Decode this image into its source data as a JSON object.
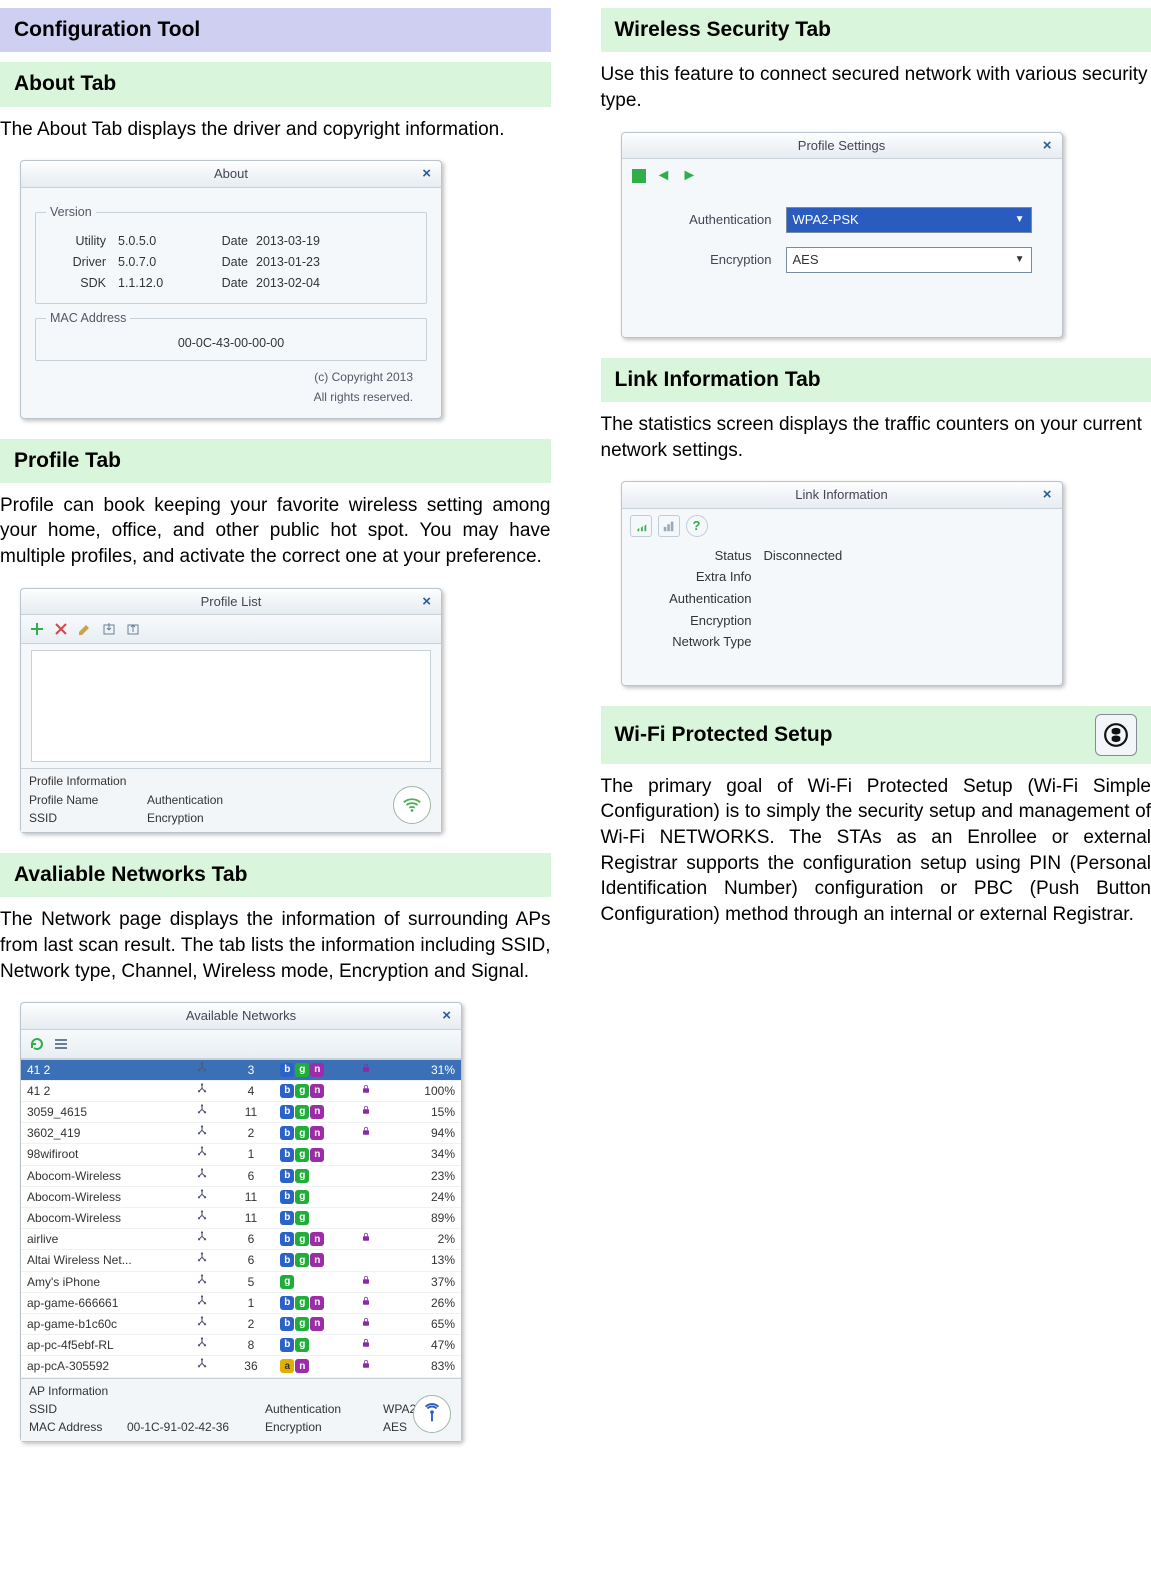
{
  "sections": {
    "config_tool": "Configuration Tool",
    "about": "About Tab",
    "profile": "Profile Tab",
    "avail": "Avaliable Networks Tab",
    "wireless_sec": "Wireless Security Tab",
    "link_info": "Link Information Tab",
    "wps": "Wi-Fi Protected Setup"
  },
  "text": {
    "about_desc": "The About Tab displays the driver and copyright information.",
    "profile_desc": "Profile can book keeping your favorite wireless setting among your home, office, and other public hot spot. You may have multiple profiles, and activate the correct one at your preference.",
    "avail_desc": "The Network page displays the information of surrounding APs from last scan result. The tab lists the information including SSID, Network type, Channel, Wireless mode, Encryption and Signal.",
    "wireless_sec_desc": "Use this feature to connect secured network with various security type.",
    "link_info_desc": "The statistics screen displays the traffic counters on your current network settings.",
    "wps_desc": "The primary goal of Wi-Fi Protected Setup (Wi-Fi Simple Configuration) is to simply the security setup and management of Wi-Fi NETWORKS. The STAs as an Enrollee or external Registrar supports the configuration setup using PIN (Personal Identification Number) configuration or PBC (Push Button Configuration) method through an internal or external Registrar."
  },
  "about_window": {
    "title": "About",
    "version_legend": "Version",
    "mac_legend": "MAC Address",
    "labels": {
      "utility": "Utility",
      "driver": "Driver",
      "sdk": "SDK",
      "date": "Date"
    },
    "utility": "5.0.5.0",
    "utility_date": "2013-03-19",
    "driver": "5.0.7.0",
    "driver_date": "2013-01-23",
    "sdk": "1.1.12.0",
    "sdk_date": "2013-02-04",
    "mac": "00-0C-43-00-00-00",
    "copyright1": "(c) Copyright 2013",
    "copyright2": "All rights reserved."
  },
  "profile_window": {
    "title": "Profile List",
    "info_legend": "Profile Information",
    "profile_name_label": "Profile Name",
    "ssid_label": "SSID",
    "auth_label": "Authentication",
    "enc_label": "Encryption"
  },
  "networks_window": {
    "title": "Available Networks",
    "ap_info_legend": "AP Information",
    "ssid_label": "SSID",
    "mac_label": "MAC Address",
    "auth_label": "Authentication",
    "enc_label": "Encryption",
    "ssid_value": "",
    "mac_value": "00-1C-91-02-42-36",
    "auth_value": "WPA2-PSK",
    "enc_value": "AES",
    "rows": [
      {
        "ssid": "41 2",
        "ch": "3",
        "modes": [
          "b",
          "g",
          "n"
        ],
        "lock": true,
        "sig": "31%",
        "sel": true
      },
      {
        "ssid": "41 2",
        "ch": "4",
        "modes": [
          "b",
          "g",
          "n"
        ],
        "lock": true,
        "sig": "100%"
      },
      {
        "ssid": "3059_4615",
        "ch": "11",
        "modes": [
          "b",
          "g",
          "n"
        ],
        "lock": true,
        "sig": "15%"
      },
      {
        "ssid": "3602_419",
        "ch": "2",
        "modes": [
          "b",
          "g",
          "n"
        ],
        "lock": true,
        "sig": "94%"
      },
      {
        "ssid": "98wifiroot",
        "ch": "1",
        "modes": [
          "b",
          "g",
          "n"
        ],
        "lock": false,
        "sig": "34%"
      },
      {
        "ssid": "Abocom-Wireless",
        "ch": "6",
        "modes": [
          "b",
          "g"
        ],
        "lock": false,
        "sig": "23%"
      },
      {
        "ssid": "Abocom-Wireless",
        "ch": "11",
        "modes": [
          "b",
          "g"
        ],
        "lock": false,
        "sig": "24%"
      },
      {
        "ssid": "Abocom-Wireless",
        "ch": "11",
        "modes": [
          "b",
          "g"
        ],
        "lock": false,
        "sig": "89%"
      },
      {
        "ssid": "airlive",
        "ch": "6",
        "modes": [
          "b",
          "g",
          "n"
        ],
        "lock": true,
        "sig": "2%"
      },
      {
        "ssid": "Altai Wireless Net...",
        "ch": "6",
        "modes": [
          "b",
          "g",
          "n"
        ],
        "lock": false,
        "sig": "13%"
      },
      {
        "ssid": "Amy's iPhone",
        "ch": "5",
        "modes": [
          "g"
        ],
        "lock": true,
        "sig": "37%"
      },
      {
        "ssid": "ap-game-666661",
        "ch": "1",
        "modes": [
          "b",
          "g",
          "n"
        ],
        "lock": true,
        "sig": "26%"
      },
      {
        "ssid": "ap-game-b1c60c",
        "ch": "2",
        "modes": [
          "b",
          "g",
          "n"
        ],
        "lock": true,
        "sig": "65%"
      },
      {
        "ssid": "ap-pc-4f5ebf-RL",
        "ch": "8",
        "modes": [
          "b",
          "g"
        ],
        "lock": true,
        "sig": "47%"
      },
      {
        "ssid": "ap-pcA-305592",
        "ch": "36",
        "modes": [
          "a",
          "n"
        ],
        "lock": true,
        "sig": "83%"
      }
    ]
  },
  "profile_settings_window": {
    "title": "Profile Settings",
    "auth_label": "Authentication",
    "enc_label": "Encryption",
    "auth_value": "WPA2-PSK",
    "enc_value": "AES"
  },
  "link_window": {
    "title": "Link Information",
    "labels": {
      "status": "Status",
      "extra": "Extra Info",
      "auth": "Authentication",
      "enc": "Encryption",
      "ntype": "Network Type"
    },
    "status_value": "Disconnected"
  }
}
